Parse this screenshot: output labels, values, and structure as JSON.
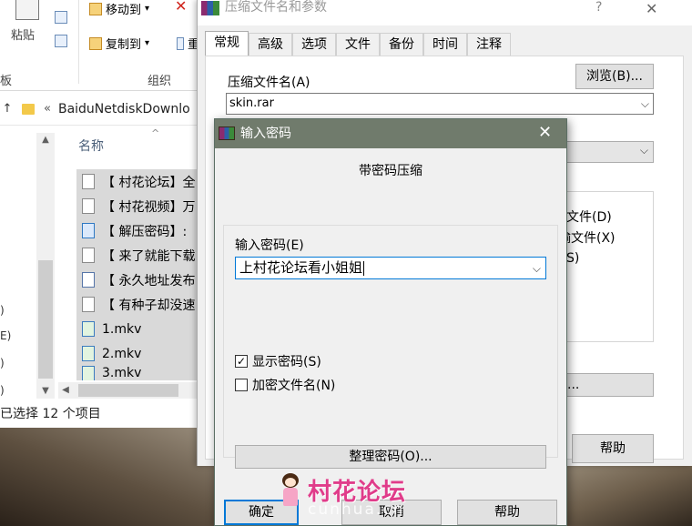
{
  "explorer": {
    "ribbon": {
      "paste_label": "粘贴",
      "move_to_label": "移动到",
      "copy_to_label": "复制到",
      "organize_label": "组织",
      "board_label": "板",
      "peek_char": "重",
      "move_arrow": "▾",
      "copy_arrow": "▾"
    },
    "address": {
      "chevron": "«",
      "path": "BaiduNetdiskDownlo"
    },
    "column_header": "名称",
    "files": [
      {
        "name": "【 村花论坛】全",
        "type": "doc"
      },
      {
        "name": "【 村花视频】万",
        "type": "doc"
      },
      {
        "name": "【 解压密码】:",
        "type": "img"
      },
      {
        "name": "【 来了就能下载",
        "type": "doc"
      },
      {
        "name": "【 永久地址发布",
        "type": "shortcut"
      },
      {
        "name": "【 有种子却没速",
        "type": "doc"
      },
      {
        "name": "1.mkv",
        "type": "video"
      },
      {
        "name": "2.mkv",
        "type": "video"
      },
      {
        "name": "3.mkv",
        "type": "video"
      }
    ],
    "nav_arrows": [
      ")",
      "E)",
      ")",
      ")"
    ],
    "status": "已选择 12 个项目"
  },
  "archive_dialog": {
    "title": "压缩文件名和参数",
    "help_glyph": "?",
    "tabs": [
      "常规",
      "高级",
      "选项",
      "文件",
      "备份",
      "时间",
      "注释"
    ],
    "active_tab": "常规",
    "archive_name_label": "压缩文件名(A)",
    "archive_name_value": "skin.rar",
    "browse_button": "浏览(B)...",
    "peek_options": [
      "文件(D)",
      "输文件(X)",
      "S)"
    ],
    "peek_button": "...",
    "help_button": "帮助"
  },
  "password_dialog": {
    "title": "输入密码",
    "subtitle": "带密码压缩",
    "enter_password_label": "输入密码(E)",
    "password_value": "上村花论坛看小姐姐",
    "show_password_label": "显示密码(S)",
    "show_password_checked": true,
    "show_password_mark": "✓",
    "encrypt_filenames_label": "加密文件名(N)",
    "encrypt_filenames_checked": false,
    "organize_button": "整理密码(O)...",
    "ok_button": "确定",
    "cancel_button": "取消",
    "help_button": "帮助"
  },
  "watermark": {
    "text": "村花论坛",
    "domain": "cunhua.cn"
  },
  "colors": {
    "password_titlebar": "#707b6c",
    "focus_blue": "#0078d7",
    "watermark_pink": "#e03c8a",
    "selection_gray": "#d9d9d9"
  }
}
